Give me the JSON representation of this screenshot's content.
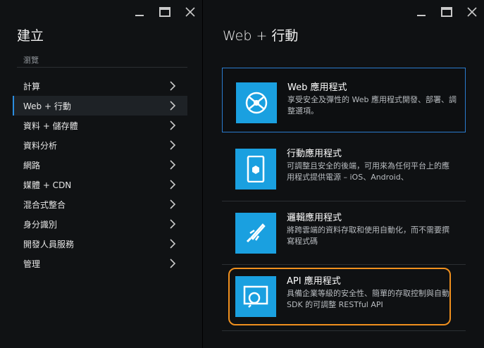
{
  "left": {
    "title": "建立",
    "browse": "瀏覽",
    "items": [
      {
        "label": "計算"
      },
      {
        "label": "Web + 行動",
        "active": true
      },
      {
        "label": "資料 + 儲存體"
      },
      {
        "label": "資料分析"
      },
      {
        "label": "網路"
      },
      {
        "label": "媒體 + CDN"
      },
      {
        "label": "混合式整合"
      },
      {
        "label": "身分識別"
      },
      {
        "label": "開發人員服務"
      },
      {
        "label": "管理"
      }
    ]
  },
  "right": {
    "title": "Web + 行動",
    "cards": [
      {
        "name": "Web 應用程式",
        "desc": "享受安全及彈性的 Web 應用程式開發、部署、調整選項。",
        "icon": "web-app-icon"
      },
      {
        "name": "行動應用程式",
        "desc": "可調整且安全的後端，可用來為任何平台上的應用程式提供電源 – iOS、Android、",
        "icon": "mobile-app-icon"
      },
      {
        "name": "邏輯應用程式",
        "desc": "將跨雲端的資料存取和使用自動化，而不需要撰寫程式碼",
        "icon": "logic-app-icon"
      },
      {
        "name": "API 應用程式",
        "desc": "具備企業等級的安全性、簡單的存取控制與自動 SDK 的可調整 RESTful API",
        "icon": "api-app-icon"
      }
    ]
  },
  "colors": {
    "accent": "#1aa0e0",
    "highlight": "#f0901e",
    "selected_border": "#2b7ccf"
  }
}
